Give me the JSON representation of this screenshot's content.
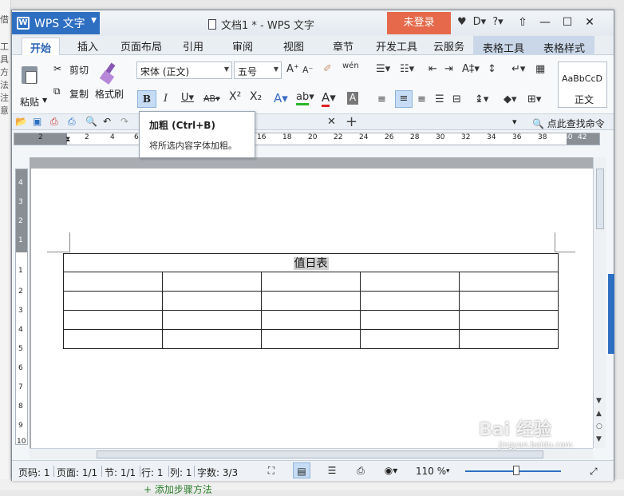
{
  "background": {
    "left_strip": [
      "借",
      "工具",
      "方法",
      "注意"
    ],
    "bottom_link": "+ 添加步骤方法"
  },
  "titlebar": {
    "app_button": "WPS 文字",
    "doc_title": "文档1 * - WPS 文字",
    "login": "未登录"
  },
  "menu": {
    "tabs": [
      "开始",
      "插入",
      "页面布局",
      "引用",
      "审阅",
      "视图",
      "章节",
      "开发工具",
      "云服务"
    ],
    "context_tabs": [
      "表格工具",
      "表格样式"
    ]
  },
  "ribbon": {
    "paste": "粘贴",
    "cut": "剪切",
    "copy": "复制",
    "format_painter": "格式刷",
    "font_name": "宋体 (正文)",
    "font_size": "五号",
    "style_preview": "AaBbCcD",
    "style_name": "正文"
  },
  "tooltip": {
    "title": "加粗 (Ctrl+B)",
    "description": "将所选内容字体加粗。"
  },
  "toolbar": {
    "find_command": "点此查找命令"
  },
  "ruler": {
    "h_labels": [
      "2",
      "2",
      "4",
      "6",
      "8",
      "10",
      "12",
      "14",
      "16",
      "18",
      "20",
      "22",
      "24",
      "26",
      "28",
      "30",
      "32",
      "34",
      "36",
      "38",
      "40",
      "42"
    ],
    "v_labels": [
      "4",
      "3",
      "2",
      "1",
      "1",
      "2",
      "3",
      "4",
      "5",
      "6",
      "7",
      "8",
      "9",
      "10"
    ]
  },
  "document": {
    "table_title": "值日表",
    "rows": 4,
    "cols": 5
  },
  "statusbar": {
    "page_code": "页码: 1",
    "pages": "页面: 1/1",
    "section": "节: 1/1",
    "row": "行: 1",
    "col": "列: 1",
    "words": "字数: 3/3",
    "zoom": "110 %"
  },
  "watermark": {
    "text": "Bai 经验",
    "sub": "jingyan.baidu.com"
  },
  "colors": {
    "app_blue": "#2e6fc2",
    "login_orange": "#e5694a",
    "selection": "#c6dcf4"
  }
}
